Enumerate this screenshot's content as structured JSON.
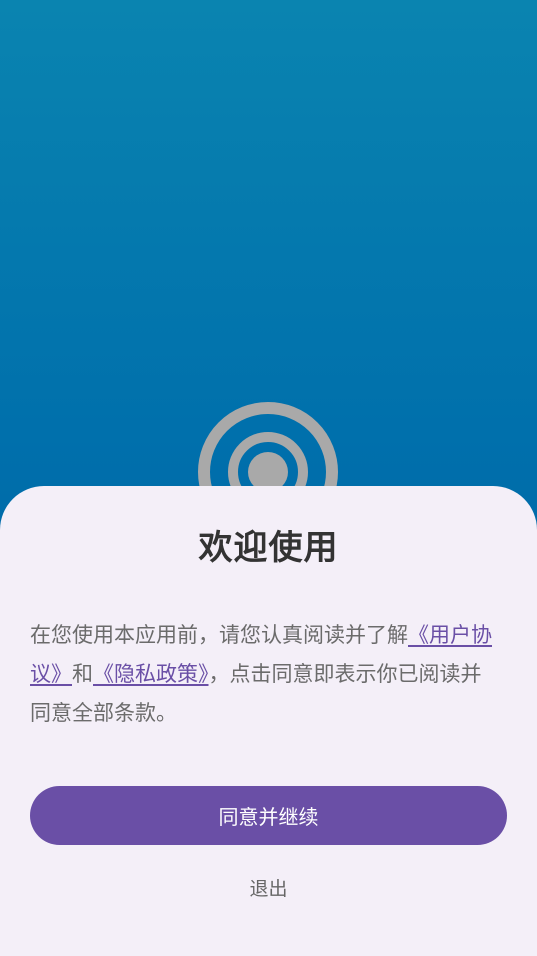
{
  "welcome": {
    "title": "欢迎使用",
    "message_prefix": "在您使用本应用前，请您认真阅读并了解",
    "user_agreement_link": "《用户协议》",
    "message_and": "和",
    "privacy_policy_link": "《隐私政策》",
    "message_suffix": "，点击同意即表示你已阅读并同意全部条款。",
    "agree_button": "同意并继续",
    "exit_button": "退出"
  },
  "icons": {
    "logo": "target-icon"
  },
  "colors": {
    "background_top": "#0a84b0",
    "background_bottom": "#035a9e",
    "sheet": "#f4eff8",
    "accent": "#6a4fa6"
  }
}
